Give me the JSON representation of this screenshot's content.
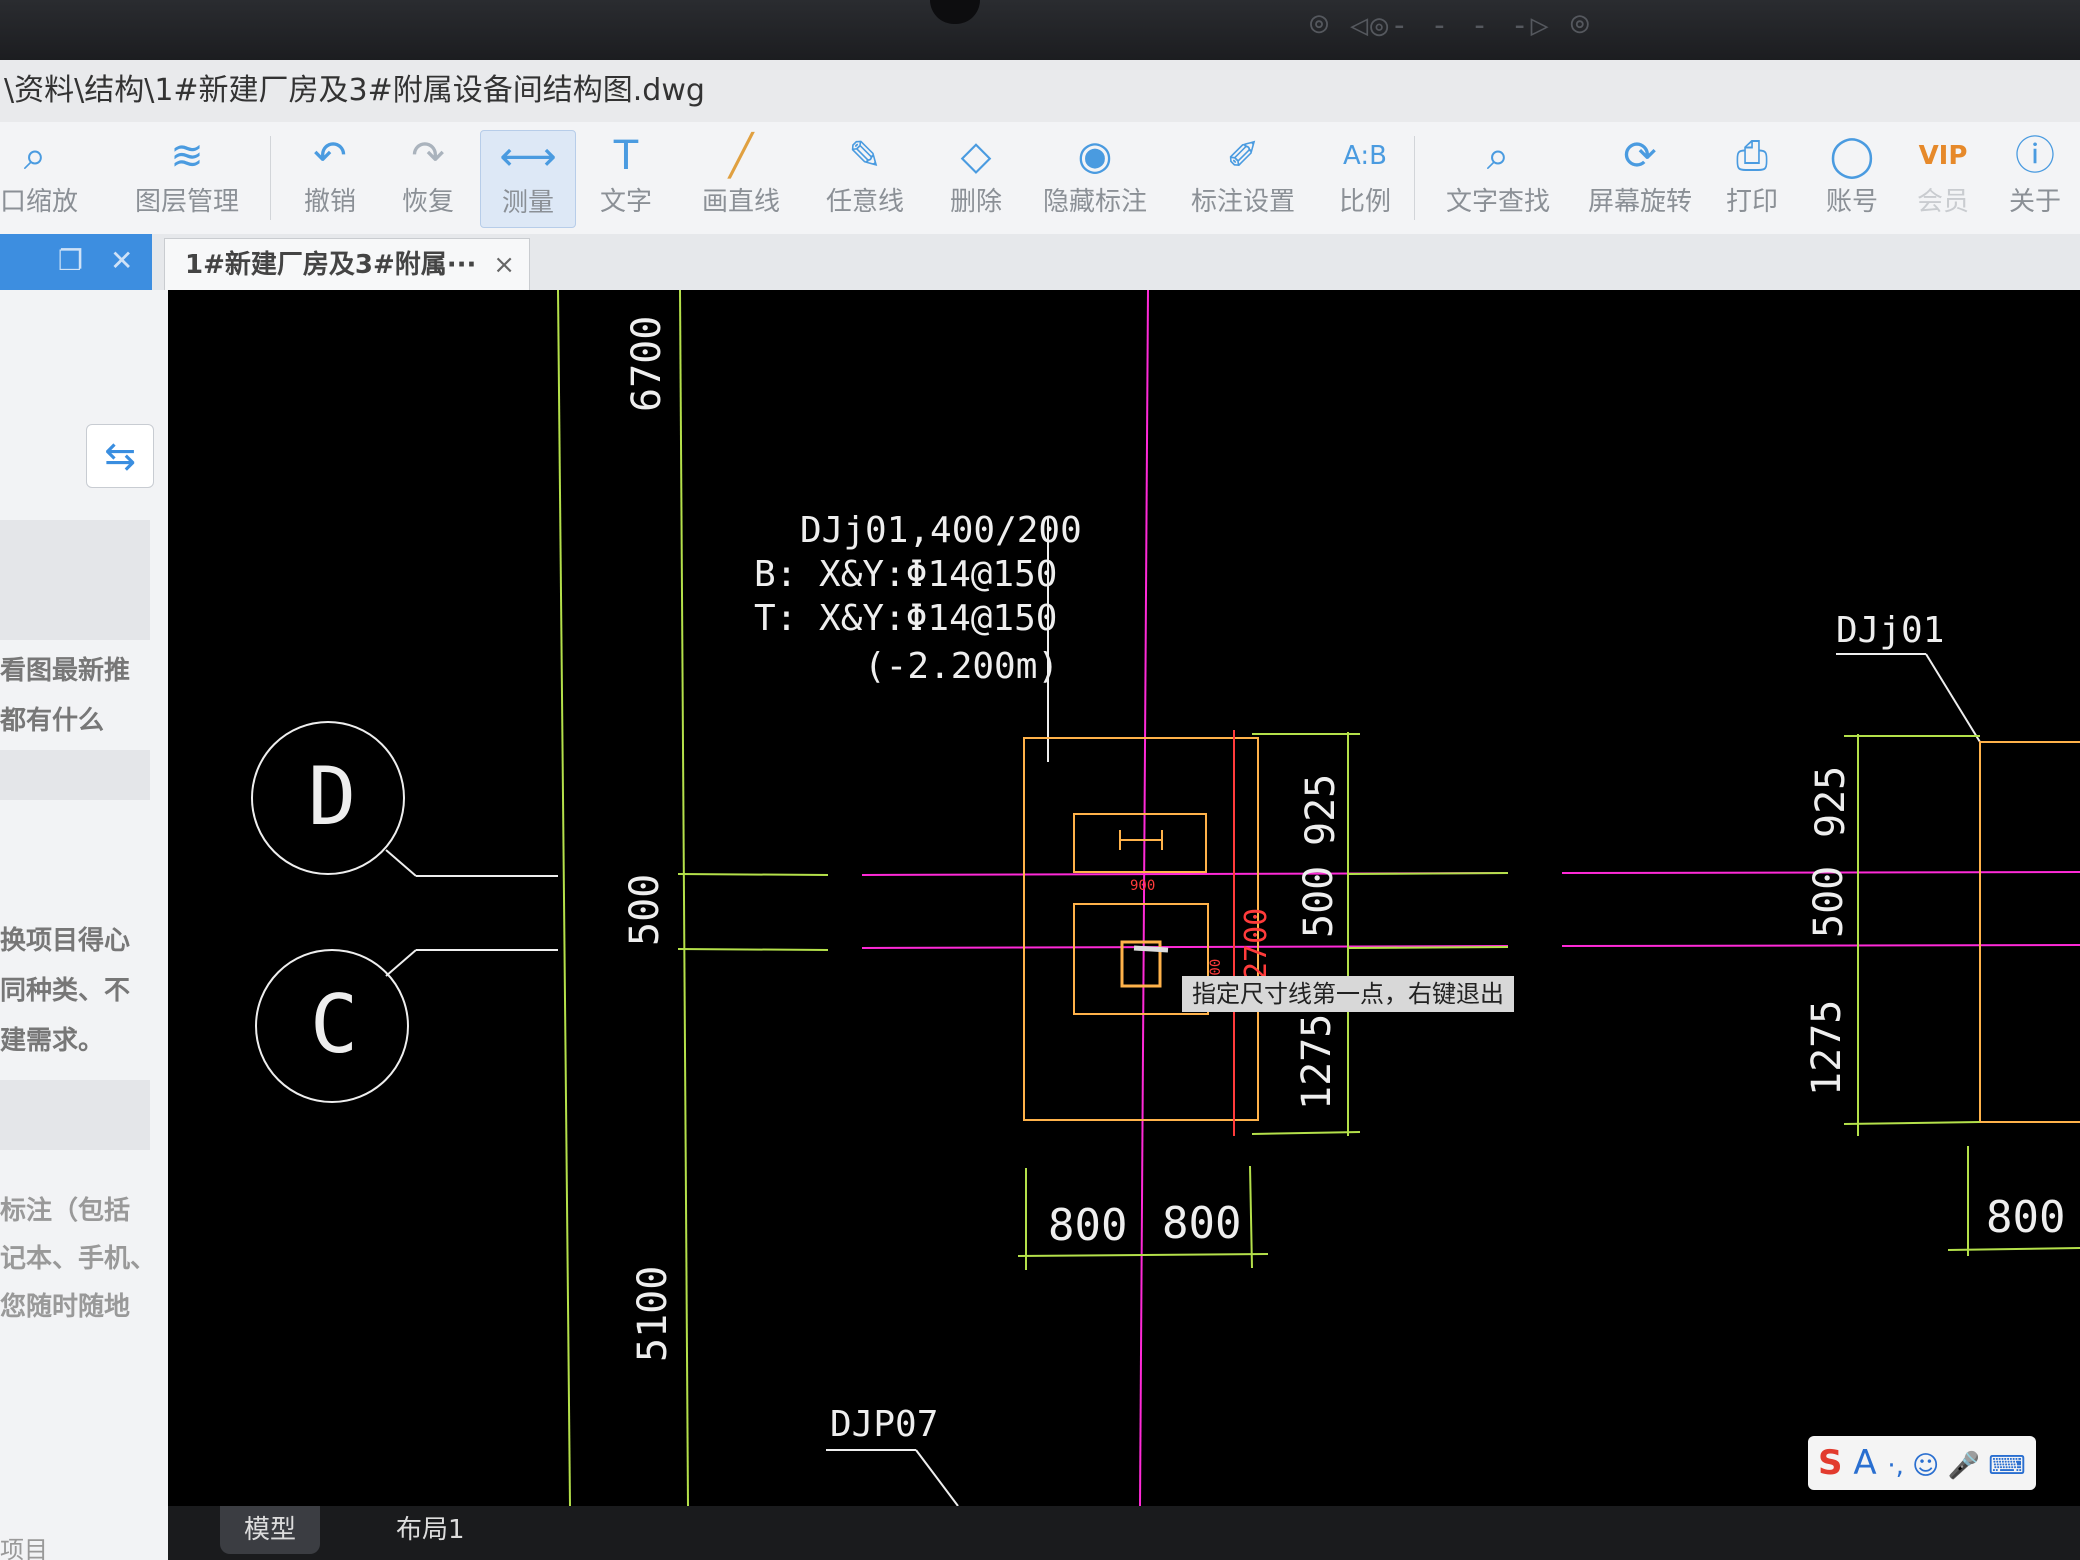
{
  "window": {
    "title": "\\资料\\结构\\1#新建厂房及3#附属设备间结构图.dwg"
  },
  "camera_bar": {
    "icons": "camera-left-icon  eye-icon  camera-right-icon"
  },
  "toolbar": {
    "items": [
      {
        "label": "口缩放",
        "icon": "zoom-window-icon"
      },
      {
        "label": "图层管理",
        "icon": "layers-icon"
      },
      {
        "label": "撤销",
        "icon": "undo-icon"
      },
      {
        "label": "恢复",
        "icon": "redo-icon"
      },
      {
        "label": "测量",
        "icon": "ruler-icon",
        "active": true
      },
      {
        "label": "文字",
        "icon": "text-icon"
      },
      {
        "label": "画直线",
        "icon": "line-icon"
      },
      {
        "label": "任意线",
        "icon": "pen-icon"
      },
      {
        "label": "删除",
        "icon": "eraser-icon"
      },
      {
        "label": "隐藏标注",
        "icon": "hide-eye-icon"
      },
      {
        "label": "标注设置",
        "icon": "annotation-settings-icon"
      },
      {
        "label": "比例",
        "icon": "scale-icon"
      },
      {
        "label": "文字查找",
        "icon": "text-search-icon"
      },
      {
        "label": "屏幕旋转",
        "icon": "rotate-screen-icon"
      },
      {
        "label": "打印",
        "icon": "printer-icon"
      },
      {
        "label": "账号",
        "icon": "user-icon"
      },
      {
        "label": "会员",
        "icon": "vip-icon"
      },
      {
        "label": "关于",
        "icon": "info-icon"
      }
    ]
  },
  "tabs": {
    "file_tab": "1#新建厂房及3#附属···",
    "close": "×"
  },
  "left_panel": {
    "lines": [
      "看图最新推",
      "都有什么",
      "换项目得心",
      "同种类、不",
      "建需求。",
      "标注（包括",
      "记本、手机、",
      "您随时随地"
    ],
    "footer": "项目"
  },
  "drawing": {
    "axis_labels": [
      "D",
      "C"
    ],
    "dim_top": "6700",
    "dim_left_mid": "500",
    "dim_bottom": "5100",
    "foundation_tag": "DJj01,400/200",
    "rebar_bottom": "B: X&Y:Φ14@150",
    "rebar_top": "T: X&Y:Φ14@150",
    "elevation": "(-2.200m)",
    "right_dims": [
      "925",
      "500",
      "1275"
    ],
    "overall_dim": "2700",
    "small_dims": [
      "900",
      "800"
    ],
    "bottom_dims": [
      "800",
      "800"
    ],
    "right_tag": "DJj01",
    "right_dims_2": [
      "925",
      "500",
      "1275"
    ],
    "right_bottom_dim": "800",
    "bottom_tag": "DJP07"
  },
  "tooltip": "指定尺寸线第一点，右键退出",
  "bottom_tabs": [
    "模型",
    "布局1"
  ],
  "ime": {
    "logo": "S",
    "mode": "A",
    "icons": "·, ☺ 🎤 ⌨"
  },
  "colors": {
    "accent": "#3d8ee0",
    "cad_bg": "#000000"
  }
}
